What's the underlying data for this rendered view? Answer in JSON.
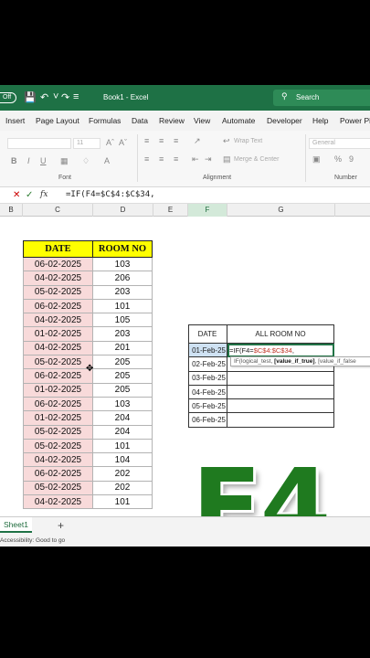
{
  "titlebar": {
    "autosave": "Off",
    "book_title": "Book1  -  Excel",
    "search_placeholder": "Search"
  },
  "tabs": [
    "Insert",
    "Page Layout",
    "Formulas",
    "Data",
    "Review",
    "View",
    "Automate",
    "Developer",
    "Help",
    "Power Pi"
  ],
  "ribbon": {
    "font_size": "11",
    "font_group": "Font",
    "alignment_group": "Alignment",
    "wrap_text": "Wrap Text",
    "merge_center": "Merge & Center",
    "number_format": "General",
    "number_group": "Number"
  },
  "formula_bar": {
    "fx": "fx",
    "formula": "=IF(F4=$C$4:$C$34,"
  },
  "columns": [
    "B",
    "C",
    "D",
    "E",
    "F",
    "G"
  ],
  "table1": {
    "headers": [
      "DATE",
      "ROOM NO"
    ],
    "rows": [
      [
        "06-02-2025",
        "103"
      ],
      [
        "04-02-2025",
        "206"
      ],
      [
        "05-02-2025",
        "203"
      ],
      [
        "06-02-2025",
        "101"
      ],
      [
        "04-02-2025",
        "105"
      ],
      [
        "01-02-2025",
        "203"
      ],
      [
        "04-02-2025",
        "201"
      ],
      [
        "05-02-2025",
        "205"
      ],
      [
        "06-02-2025",
        "205"
      ],
      [
        "01-02-2025",
        "205"
      ],
      [
        "06-02-2025",
        "103"
      ],
      [
        "01-02-2025",
        "204"
      ],
      [
        "05-02-2025",
        "204"
      ],
      [
        "05-02-2025",
        "101"
      ],
      [
        "04-02-2025",
        "104"
      ],
      [
        "06-02-2025",
        "202"
      ],
      [
        "05-02-2025",
        "202"
      ],
      [
        "04-02-2025",
        "101"
      ]
    ]
  },
  "table2": {
    "headers": [
      "DATE",
      "ALL ROOM NO"
    ],
    "dates": [
      "01-Feb-25",
      "02-Feb-25",
      "03-Feb-25",
      "04-Feb-25",
      "05-Feb-25",
      "06-Feb-25"
    ],
    "edit_prefix": "=IF(F4=",
    "edit_ref": "$C$4:$C$34",
    "edit_suffix": ","
  },
  "tooltip": {
    "func": "IF(logical_test, ",
    "bold_arg": "[value_if_true]",
    "rest": ", [value_if_false"
  },
  "overlay_text": "F4",
  "sheet_tab": "Sheet1",
  "add_sheet": "+",
  "status": "Accessibility: Good to go"
}
